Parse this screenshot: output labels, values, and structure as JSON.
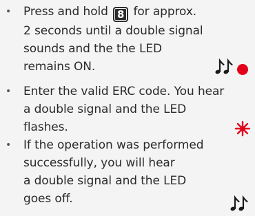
{
  "steps": [
    {
      "bullet": "•",
      "before_key": "Press and hold",
      "key_label": "8",
      "after_key": "for approx.",
      "lines": [
        "2 seconds until a double signal",
        "sounds and the the LED",
        "remains ON."
      ]
    },
    {
      "bullet": "•",
      "lines": [
        "Enter the valid ERC code. You hear",
        "a double signal and the LED",
        "flashes."
      ]
    },
    {
      "bullet": "•",
      "lines": [
        "If the operation was performed",
        "successfully, you will hear",
        "a double signal and the LED",
        "goes off."
      ]
    }
  ],
  "icons": {
    "step1": [
      "double-note-icon",
      "led-on-icon"
    ],
    "step2": [
      "led-flashing-icon"
    ],
    "step3": [
      "double-note-icon"
    ]
  },
  "colors": {
    "led_red": "#e3001b",
    "text": "#2b2b2b",
    "background": "#f4f4f4"
  }
}
